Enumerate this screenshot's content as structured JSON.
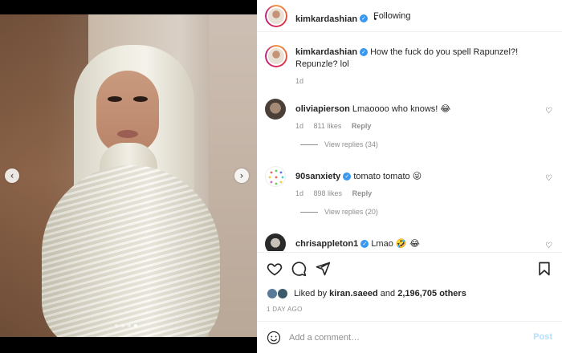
{
  "post": {
    "author": "kimkardashian",
    "follow_status": "Following",
    "more_label": "•••",
    "caption_text": "How the fuck do you spell Rapunzel?! Repunzle? lol",
    "caption_time": "1d",
    "media": {
      "slides": 4,
      "active_slide": 4,
      "prev_label": "‹",
      "next_label": "›"
    }
  },
  "comments": [
    {
      "user": "oliviapierson",
      "verified": false,
      "text": "Lmaoooo who knows!",
      "emoji": "😂",
      "time": "1d",
      "likes": "811 likes",
      "reply": "Reply",
      "view_replies": "View replies (34)"
    },
    {
      "user": "90sanxiety",
      "verified": true,
      "text": "tomato tomato",
      "emoji": "😜",
      "time": "1d",
      "likes": "898 likes",
      "reply": "Reply",
      "view_replies": "View replies (20)"
    },
    {
      "user": "chrisappleton1",
      "verified": true,
      "text": "Lmao",
      "emoji": "🤣 😂",
      "time": "",
      "likes": "",
      "reply": "",
      "view_replies": ""
    }
  ],
  "engagement": {
    "liked_by_prefix": "Liked by",
    "liked_by_user": "kiran.saeed",
    "liked_by_and": "and",
    "others_count": "2,196,705 others",
    "date": "1 DAY AGO"
  },
  "composer": {
    "placeholder": "Add a comment…",
    "post_label": "Post"
  },
  "icons": {
    "like": "heart-icon",
    "comment": "comment-icon",
    "share": "send-icon",
    "save": "bookmark-icon",
    "emoji": "smiley-icon"
  },
  "colors": {
    "verified": "#3897f0",
    "post_button": "#b2dffc",
    "meta": "#8e8e8e"
  }
}
